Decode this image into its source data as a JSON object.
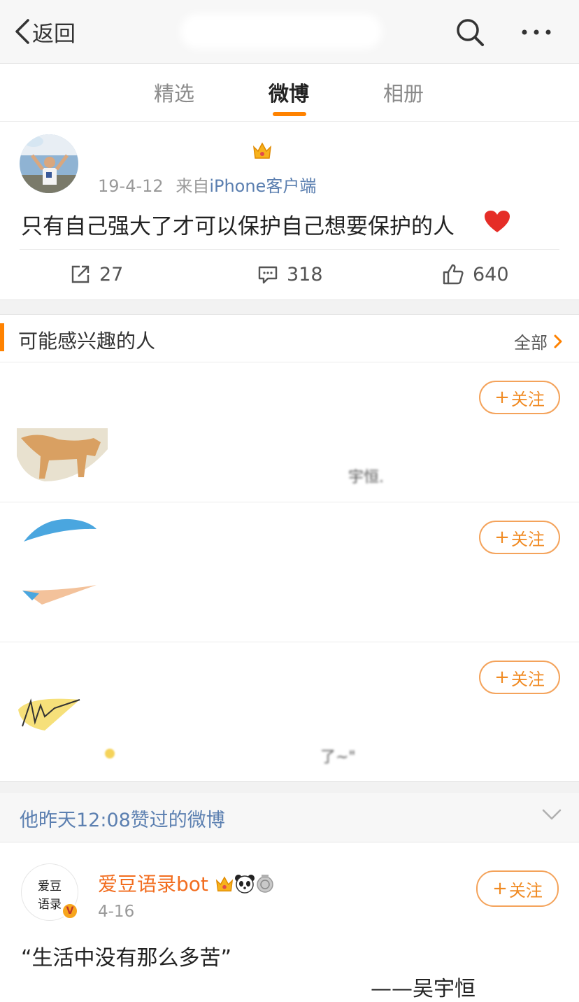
{
  "header": {
    "back_label": "返回",
    "icons": [
      "chevron-left-icon",
      "search-icon",
      "more-icon"
    ]
  },
  "tabs": [
    {
      "label": "精选",
      "active": false
    },
    {
      "label": "微博",
      "active": true
    },
    {
      "label": "相册",
      "active": false
    }
  ],
  "accent_color": "#ff8200",
  "post": {
    "meta_date": "19-4-12",
    "meta_from": "来自",
    "meta_source": "iPhone客户端",
    "text": "只有自己强大了才可以保护自己想要保护的人",
    "emoji": "red-heart",
    "reposts": "27",
    "comments": "318",
    "likes": "640"
  },
  "suggestions": {
    "title": "可能感兴趣的人",
    "all_label": "全部",
    "follow_label": "关注",
    "fragments": [
      "宇恒.",
      "了~\""
    ]
  },
  "liked": {
    "text": "他昨天12:08赞过的微博"
  },
  "quote_post": {
    "avatar_line1": "爱豆",
    "avatar_line2": "语录",
    "verified_badge": "V",
    "name": "爱豆语录bot",
    "date": "4-16",
    "follow_label": "关注",
    "text": "“生活中没有那么多苦”",
    "author": "——吴宇恒"
  }
}
